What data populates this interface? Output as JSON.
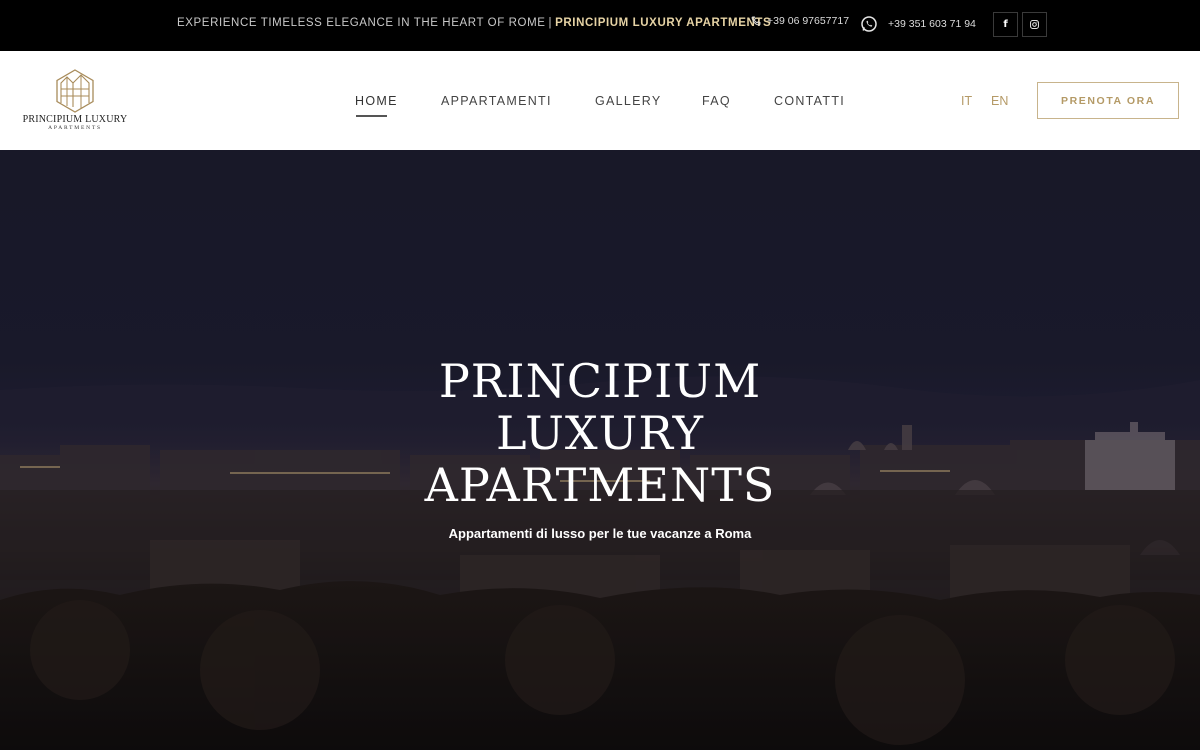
{
  "topbar": {
    "tagline": "EXPERIENCE TIMELESS ELEGANCE IN THE HEART OF ROME",
    "separator": "|",
    "brand": "PRINCIPIUM LUXURY APARTMENTS",
    "phone": "+39 06 97657717",
    "whatsapp": "+39 351 603 71 94",
    "social": [
      {
        "name": "facebook",
        "glyph": "f"
      },
      {
        "name": "instagram",
        "icon": "instagram-icon"
      }
    ]
  },
  "header": {
    "logo": {
      "name": "PRINCIPIUM LUXURY",
      "sub": "APARTMENTS"
    },
    "nav": [
      {
        "label": "HOME",
        "active": true
      },
      {
        "label": "APPARTAMENTI",
        "active": false
      },
      {
        "label": "GALLERY",
        "active": false
      },
      {
        "label": "FAQ",
        "active": false
      },
      {
        "label": "CONTATTI",
        "active": false
      }
    ],
    "languages": [
      "IT",
      "EN"
    ],
    "cta": "PRENOTA ORA"
  },
  "hero": {
    "title_lines": [
      "PRINCIPIUM",
      "LUXURY",
      "APARTMENTS"
    ],
    "subtitle": "Appartamenti di lusso per le tue vacanze a Roma"
  },
  "colors": {
    "gold": "#b49a66",
    "brand_gold_light": "#e6d3a5",
    "topbar_bg": "#000000",
    "hero_night": "#1c1c2e"
  }
}
